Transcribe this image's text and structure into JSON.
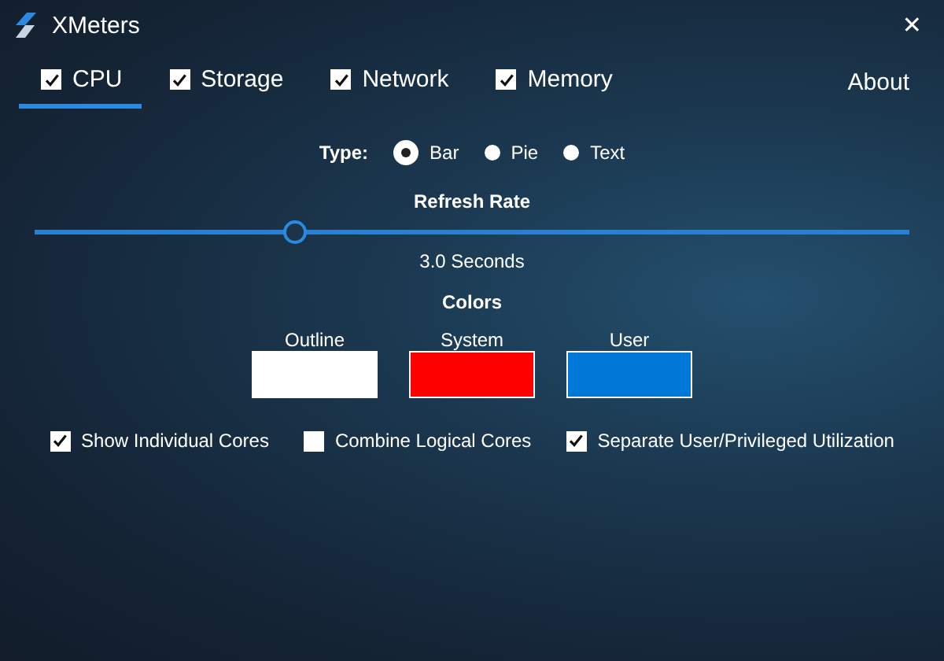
{
  "window": {
    "title": "XMeters",
    "close": "✕"
  },
  "tabs": [
    {
      "label": "CPU",
      "checked": true,
      "selected": true
    },
    {
      "label": "Storage",
      "checked": true,
      "selected": false
    },
    {
      "label": "Network",
      "checked": true,
      "selected": false
    },
    {
      "label": "Memory",
      "checked": true,
      "selected": false
    }
  ],
  "about": "About",
  "type": {
    "label": "Type:",
    "options": [
      {
        "label": "Bar",
        "selected": true
      },
      {
        "label": "Pie",
        "selected": false
      },
      {
        "label": "Text",
        "selected": false
      }
    ]
  },
  "refresh": {
    "title": "Refresh Rate",
    "level": 0.297,
    "reading": "3.0 Seconds"
  },
  "colors": {
    "title": "Colors",
    "swatches": [
      {
        "label": "Outline",
        "color": "#ffffff"
      },
      {
        "label": "System",
        "color": "#ff0000"
      },
      {
        "label": "User",
        "color": "#0078d7"
      }
    ]
  },
  "options": [
    {
      "label": "Show Individual Cores",
      "checked": true
    },
    {
      "label": "Combine Logical Cores",
      "checked": false
    },
    {
      "label": "Separate User/Privileged Utilization",
      "checked": true
    }
  ]
}
